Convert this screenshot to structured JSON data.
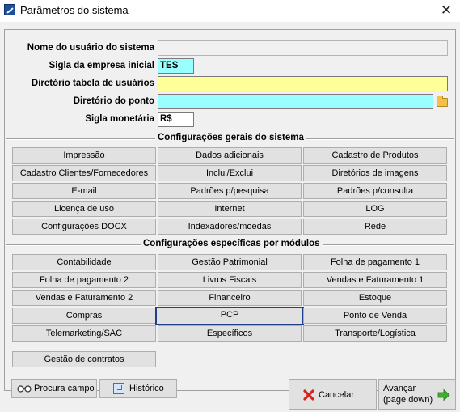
{
  "window": {
    "title": "Parâmetros do sistema"
  },
  "fields": {
    "usuario": {
      "label": "Nome do usuário do sistema",
      "value": ""
    },
    "sigla_empresa": {
      "label": "Sigla da empresa inicial",
      "value": "TES"
    },
    "dir_usuarios": {
      "label": "Diretório tabela de usuários",
      "value": ""
    },
    "dir_ponto": {
      "label": "Diretório do ponto",
      "value": ""
    },
    "sigla_monetaria": {
      "label": "Sigla monetária",
      "value": "R$"
    }
  },
  "sections": {
    "gerais": {
      "title": "Configurações gerais do sistema",
      "buttons": [
        "Impressão",
        "Dados adicionais",
        "Cadastro de Produtos",
        "Cadastro Clientes/Fornecedores",
        "Inclui/Exclui",
        "Diretórios de imagens",
        "E-mail",
        "Padrões p/pesquisa",
        "Padrões p/consulta",
        "Licença de uso",
        "Internet",
        "LOG",
        "Configurações DOCX",
        "Indexadores/moedas",
        "Rede"
      ]
    },
    "modulos": {
      "title": "Configurações específicas por módulos",
      "buttons": [
        "Contabilidade",
        "Gestão Patrimonial",
        "Folha de pagamento 1",
        "Folha de pagamento 2",
        "Livros Fiscais",
        "Vendas e Faturamento 1",
        "Vendas e Faturamento 2",
        "Financeiro",
        "Estoque",
        "Compras",
        "PCP",
        "Ponto de Venda",
        "Telemarketing/SAC",
        "Específicos",
        "Transporte/Logística",
        "Gestão de contratos"
      ],
      "focused": "PCP"
    }
  },
  "bottom": {
    "procura": "Procura campo",
    "historico": "Histórico",
    "cancelar": "Cancelar",
    "avancar_line1": "Avançar",
    "avancar_line2": "(page down)"
  },
  "colors": {
    "yellow_field": "#ffff99",
    "cyan_field": "#99ffff",
    "focus_border": "#1f3f8a"
  }
}
